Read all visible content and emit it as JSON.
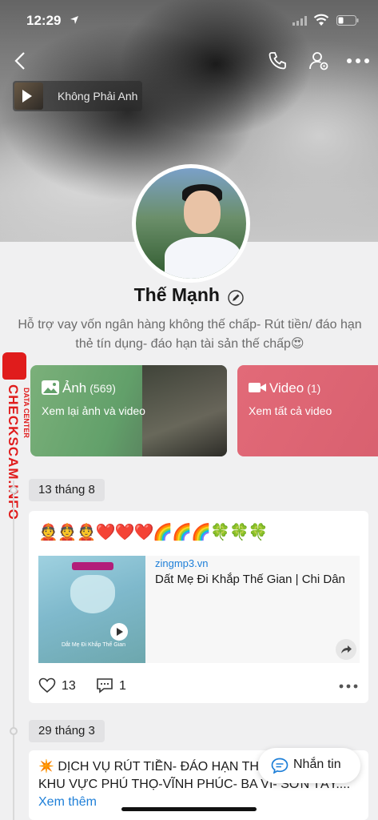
{
  "status_bar": {
    "time": "12:29"
  },
  "music": {
    "title": "Không Phải Anh"
  },
  "profile": {
    "name": "Thế Mạnh",
    "bio": "Hỗ trợ vay vốn ngân hàng không thế chấp- Rút tiền/ đáo hạn thẻ tín dụng- đáo hạn tài sản thế chấp😍"
  },
  "media_tiles": {
    "photos": {
      "label": "Ảnh",
      "count": "(569)",
      "subtitle": "Xem lại ảnh và video"
    },
    "video": {
      "label": "Video",
      "count": "(1)",
      "subtitle": "Xem tất cả video"
    }
  },
  "watermark": {
    "brand": "CHECKSCAM.INFO",
    "sub": "DATA CENTER"
  },
  "posts": [
    {
      "date": "13 tháng 8",
      "emojis": "👲👲👲❤️❤️❤️🌈🌈🌈🍀🍀🍀",
      "link": {
        "domain": "zingmp3.vn",
        "title": "Dất Mẹ Đi Khắp Thế Gian | Chi Dân",
        "thumb_caption": "Dắt Mẹ Đi Khắp Thế Gian"
      },
      "likes": "13",
      "comments": "1"
    },
    {
      "date": "29 tháng 3",
      "text": "✴️ DỊCH VỤ RÚT TIỀN- ĐÁO HẠN THẺ TÍN DỤNG KHU VỰC PHÚ THỌ-VĨNH PHÚC- BA VI- SƠN TÂY.... ",
      "see_more": "Xem thêm"
    }
  ],
  "message_button": {
    "label": "Nhắn tin"
  },
  "colors": {
    "link": "#1e7fd8",
    "photos_tile": "#62a06a",
    "video_tile": "#d8606f",
    "watermark": "#e01c1c"
  }
}
